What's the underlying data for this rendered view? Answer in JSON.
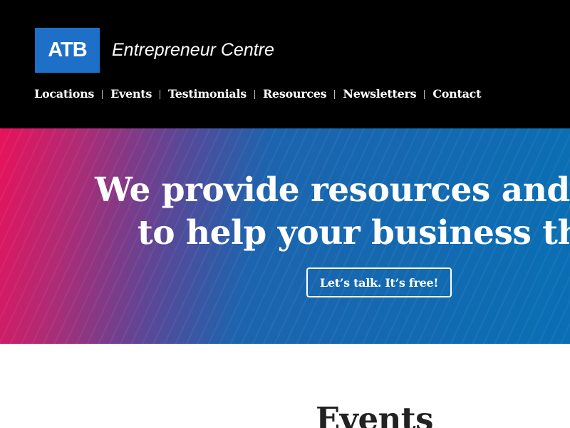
{
  "header": {
    "logo_text": "ATB",
    "site_name": "Entrepreneur Centre",
    "nav": [
      {
        "label": "Locations"
      },
      {
        "label": "Events"
      },
      {
        "label": "Testimonials"
      },
      {
        "label": "Resources"
      },
      {
        "label": "Newsletters"
      },
      {
        "label": "Contact"
      }
    ]
  },
  "hero": {
    "line1": "We provide resources and a",
    "line2": "to help your business thr",
    "cta_label": "Let’s talk. It’s free!"
  },
  "events": {
    "title": "Events"
  },
  "colors": {
    "header_bg": "#000000",
    "logo_bg": "#1e6fc8",
    "hero_gradient_start": "#e8125b",
    "hero_gradient_end": "#0a6fb4",
    "text_dark": "#222222"
  }
}
